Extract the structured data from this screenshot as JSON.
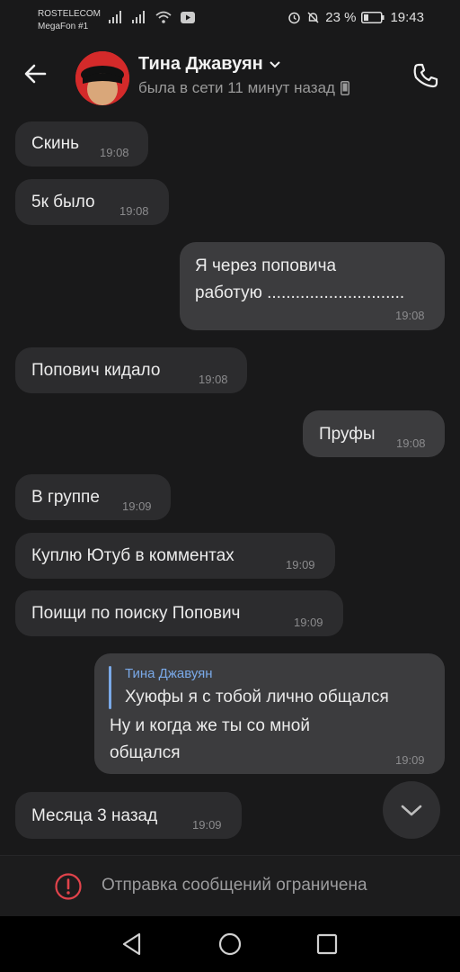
{
  "status_bar": {
    "carrier_1": "ROSTELECOM",
    "carrier_2": "MegaFon #1",
    "battery": "23 %",
    "time": "19:43"
  },
  "header": {
    "name": "Тина Джавуян",
    "last_seen": "была в сети 11 минут назад"
  },
  "messages": [
    {
      "text": "Скинь",
      "time": "19:08",
      "dir": "in"
    },
    {
      "text": "5к было",
      "time": "19:08",
      "dir": "in"
    },
    {
      "line1": "Я через поповича",
      "line2": "работую .............................",
      "time": "19:08",
      "dir": "out"
    },
    {
      "text": "Попович кидало",
      "time": "19:08",
      "dir": "in"
    },
    {
      "text": "Пруфы",
      "time": "19:08",
      "dir": "out"
    },
    {
      "text": "В группе",
      "time": "19:09",
      "dir": "in"
    },
    {
      "text": "Куплю Ютуб в комментах",
      "time": "19:09",
      "dir": "in"
    },
    {
      "text": "Поищи по поиску Попович",
      "time": "19:09",
      "dir": "in"
    },
    {
      "reply_author": "Тина Джавуян",
      "reply_text": "Хуюфы я с тобой лично общался",
      "line1": "Ну и когда же ты со мной",
      "line2": "общался",
      "time": "19:09",
      "dir": "out"
    },
    {
      "text": "Месяца 3 назад",
      "time": "19:09",
      "dir": "in"
    }
  ],
  "footer": {
    "restricted_text": "Отправка сообщений ограничена"
  },
  "colors": {
    "background": "#19191a",
    "incoming_bubble": "#2c2c2e",
    "outgoing_bubble": "#3c3c3e",
    "reply_accent": "#7aa9e8",
    "warning": "#e0434b"
  },
  "icons": [
    "back-arrow-icon",
    "chevron-down-icon",
    "phone-icon",
    "call-icon",
    "warning-icon",
    "back-nav-icon",
    "home-nav-icon",
    "recents-nav-icon",
    "scroll-down-icon"
  ]
}
